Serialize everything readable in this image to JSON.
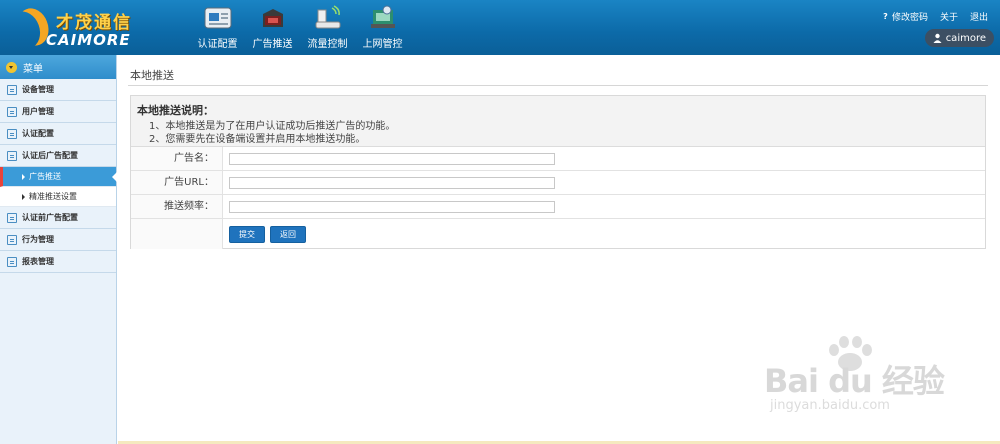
{
  "brand": {
    "cn": "才茂通信",
    "en": "CAIMORE"
  },
  "topnav": [
    {
      "label": "认证配置",
      "icon": "auth-config-icon"
    },
    {
      "label": "广告推送",
      "icon": "ad-push-icon"
    },
    {
      "label": "流量控制",
      "icon": "traffic-control-icon"
    },
    {
      "label": "上网管控",
      "icon": "internet-control-icon"
    }
  ],
  "toplinks": {
    "change_password": "修改密码",
    "about": "关于",
    "logout": "退出"
  },
  "user": {
    "name": "caimore"
  },
  "sidebar": {
    "menu_title": "菜单",
    "items": [
      {
        "label": "设备管理"
      },
      {
        "label": "用户管理"
      },
      {
        "label": "认证配置"
      },
      {
        "label": "认证后广告配置"
      }
    ],
    "subitems": [
      {
        "label": "广告推送"
      },
      {
        "label": "精准推送设置"
      }
    ],
    "items_after": [
      {
        "label": "认证前广告配置"
      },
      {
        "label": "行为管理"
      },
      {
        "label": "报表管理"
      }
    ]
  },
  "main": {
    "title": "本地推送",
    "desc_title": "本地推送说明：",
    "desc_lines": [
      "1、本地推送是为了在用户认证成功后推送广告的功能。",
      "2、您需要先在设备端设置并启用本地推送功能。"
    ],
    "fields": [
      {
        "label": "广告名：",
        "value": ""
      },
      {
        "label": "广告URL：",
        "value": ""
      },
      {
        "label": "推送频率：",
        "value": ""
      }
    ],
    "submit_label": "提交",
    "back_label": "返回"
  },
  "watermark": {
    "text": "Bai du 经验",
    "url": "jingyan.baidu.com"
  },
  "colors": {
    "header": "#0c6aa8",
    "accent": "#3b9bd8",
    "button": "#1f73bd",
    "active_marker": "#e8433b"
  }
}
